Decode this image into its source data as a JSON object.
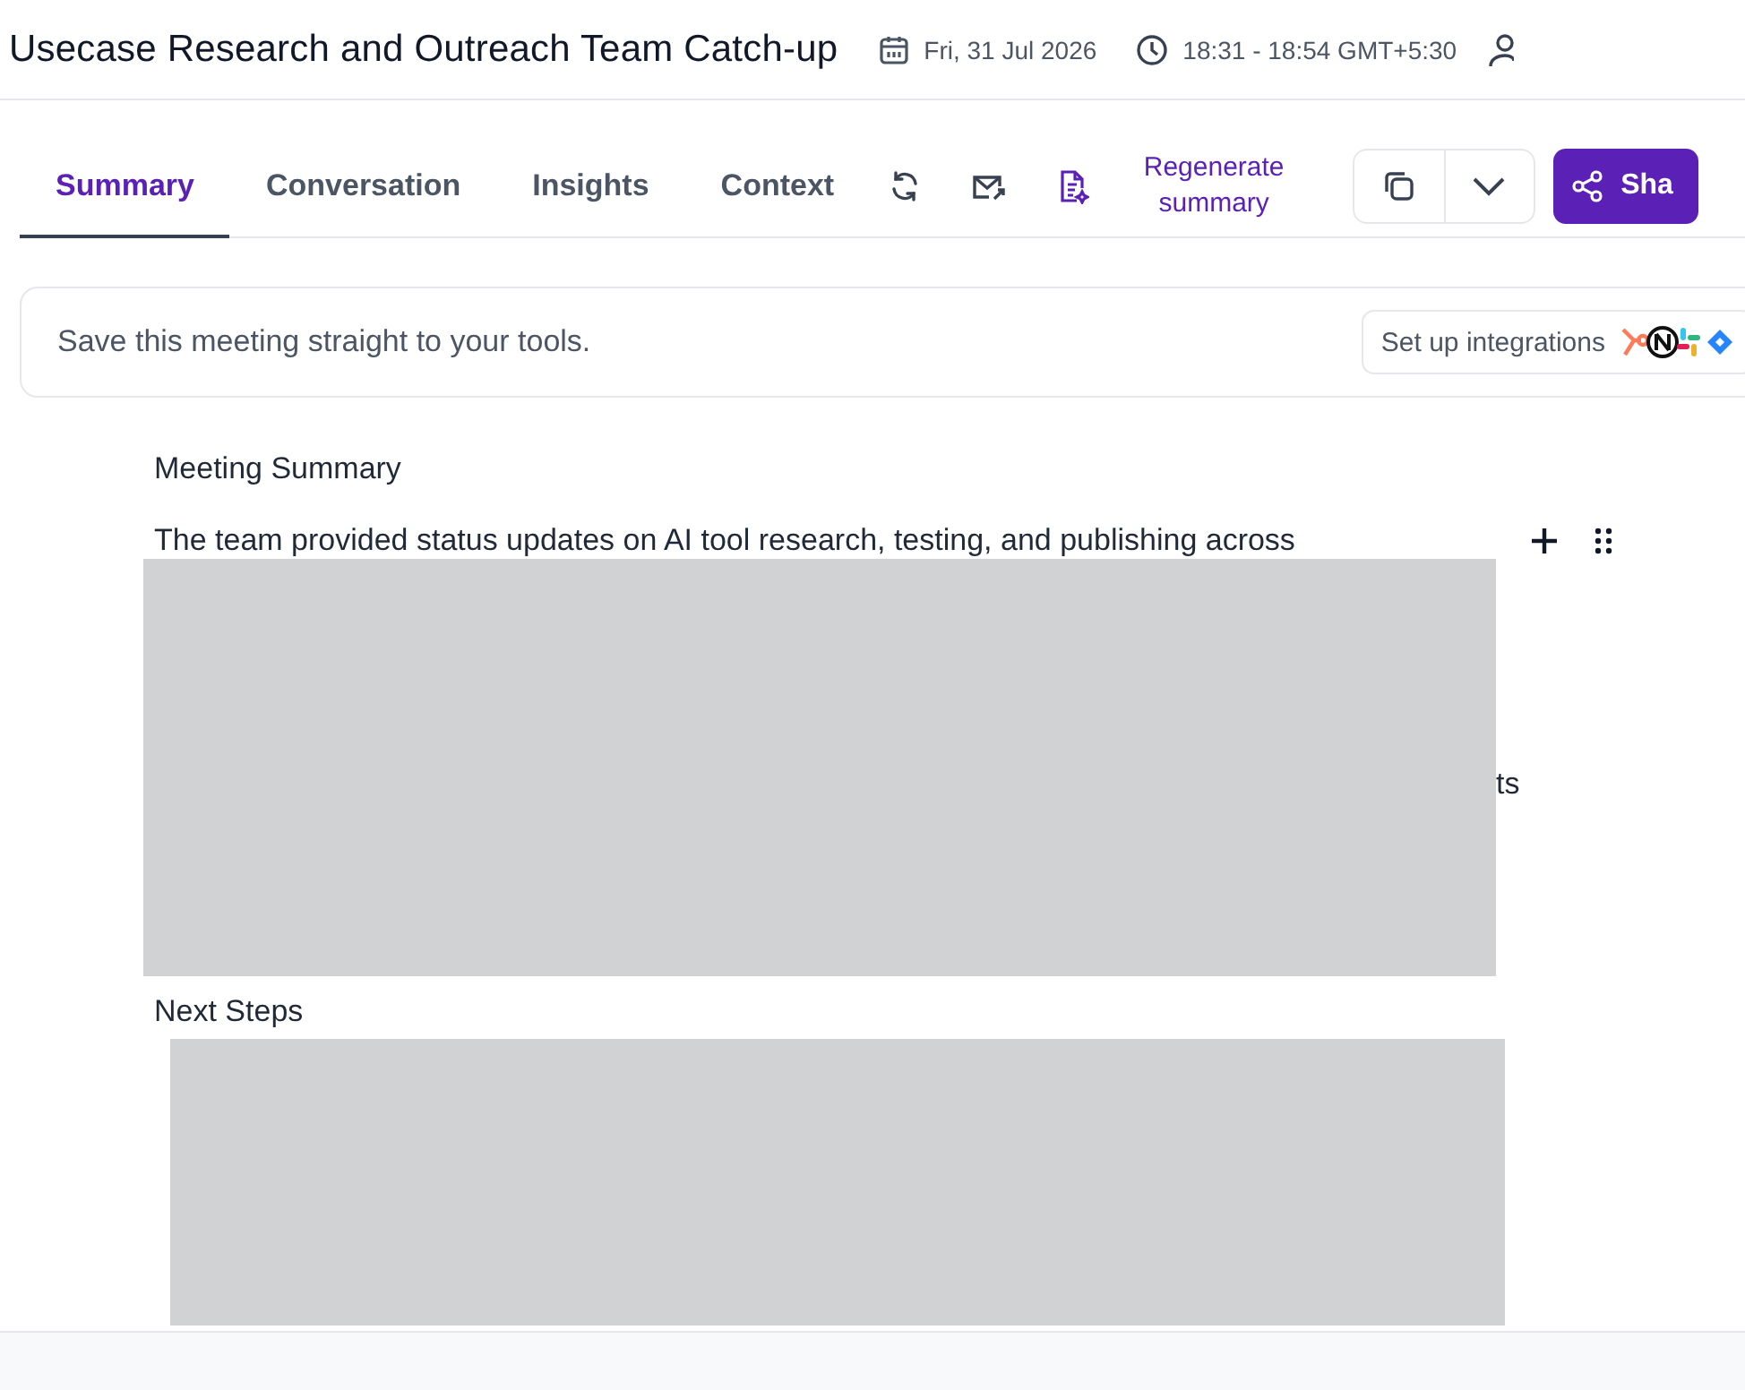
{
  "header": {
    "title": "Usecase Research and Outreach Team Catch-up",
    "date": "Fri, 31 Jul 2026",
    "time": "18:31 - 18:54 GMT+5:30"
  },
  "tabs": [
    {
      "label": "Summary",
      "selected": true
    },
    {
      "label": "Conversation",
      "selected": false
    },
    {
      "label": "Insights",
      "selected": false
    },
    {
      "label": "Context",
      "selected": false
    }
  ],
  "toolbar": {
    "regenerate_label": "Regenerate summary",
    "share_label": "Sha"
  },
  "banner": {
    "text": "Save this meeting straight to your tools.",
    "button": "Set up integrations"
  },
  "summary": {
    "heading": "Meeting Summary",
    "first_line": "The team provided status updates on AI tool research, testing, and publishing across",
    "fragment": "ts"
  },
  "next_steps": {
    "heading": "Next Steps"
  }
}
